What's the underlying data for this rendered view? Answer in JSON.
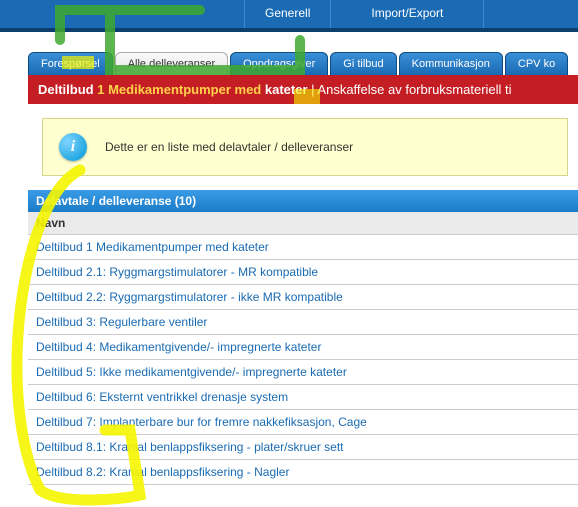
{
  "topnav": {
    "generell": "Generell",
    "import_export": "Import/Export"
  },
  "tabs": [
    {
      "label": "Forespørsel",
      "active": false
    },
    {
      "label": "Alle delleveranser",
      "active": true
    },
    {
      "label": "Oppdragsgiver",
      "active": false
    },
    {
      "label": "Gi tilbud",
      "active": false
    },
    {
      "label": "Kommunikasjon",
      "active": false
    },
    {
      "label": "CPV ko",
      "active": false
    }
  ],
  "titlebar": {
    "prefix": "Deltilbud",
    "num": "1",
    "main": "Medikamentpumper med",
    "last": "kateter",
    "suffix": "Anskaffelse av forbruksmateriell ti"
  },
  "infobox": {
    "text": "Dette er en liste med delavtaler / delleveranser"
  },
  "section": {
    "header": "Delavtale / delleveranse (10)",
    "count": 10,
    "column": "Navn",
    "rows": [
      "Deltilbud 1 Medikamentpumper med kateter",
      "Deltilbud 2.1: Ryggmargstimulatorer - MR kompatible",
      "Deltilbud 2.2: Ryggmargstimulatorer - ikke MR kompatible",
      "Deltilbud 3: Regulerbare ventiler",
      "Deltilbud 4: Medikamentgivende/- impregnerte kateter",
      "Deltilbud 5: Ikke medikamentgivende/- impregnerte kateter",
      "Deltilbud 6: Eksternt ventrikkel drenasje system",
      "Deltilbud 7: Implanterbare bur for fremre nakkefiksasjon, Cage",
      "Deltilbud 8.1: Kranial benlappsfiksering - plater/skruer sett",
      "Deltilbud 8.2: Kranial benlappsfiksering - Nagler"
    ]
  }
}
